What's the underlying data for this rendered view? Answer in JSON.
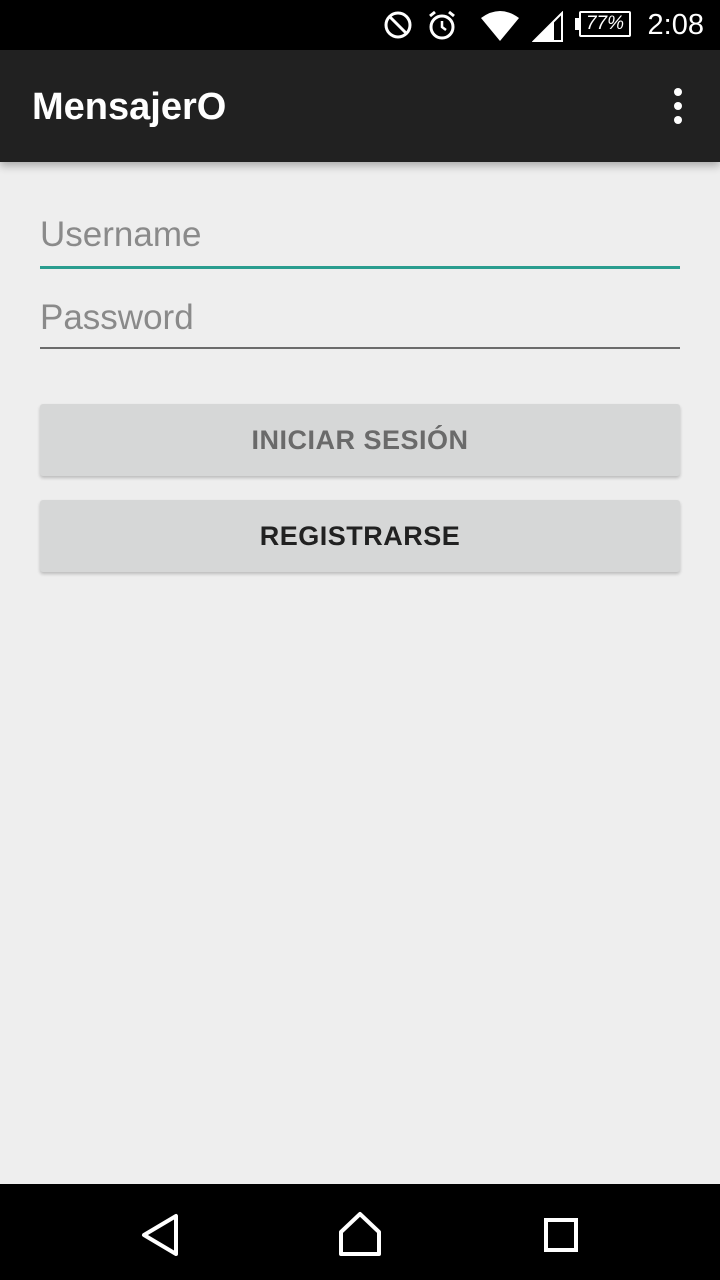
{
  "status_bar": {
    "time": "2:08",
    "battery_percent": "77%",
    "icons": [
      "do-not-disturb-icon",
      "alarm-icon",
      "wifi-icon",
      "cellular-signal-icon",
      "battery-icon"
    ]
  },
  "app_bar": {
    "title": "MensajerO",
    "menu_icon": "overflow-menu-icon"
  },
  "form": {
    "username": {
      "value": "",
      "placeholder": "Username"
    },
    "password": {
      "value": "",
      "placeholder": "Password"
    },
    "login_label": "INICIAR SESIÓN",
    "register_label": "REGISTRARSE"
  },
  "nav_bar": {
    "icons": [
      "back-icon",
      "home-icon",
      "recents-icon"
    ]
  },
  "colors": {
    "status_bar": "#000000",
    "app_bar": "#212121",
    "background": "#eeeeee",
    "accent": "#2a9d8f",
    "button": "#d6d7d7"
  }
}
